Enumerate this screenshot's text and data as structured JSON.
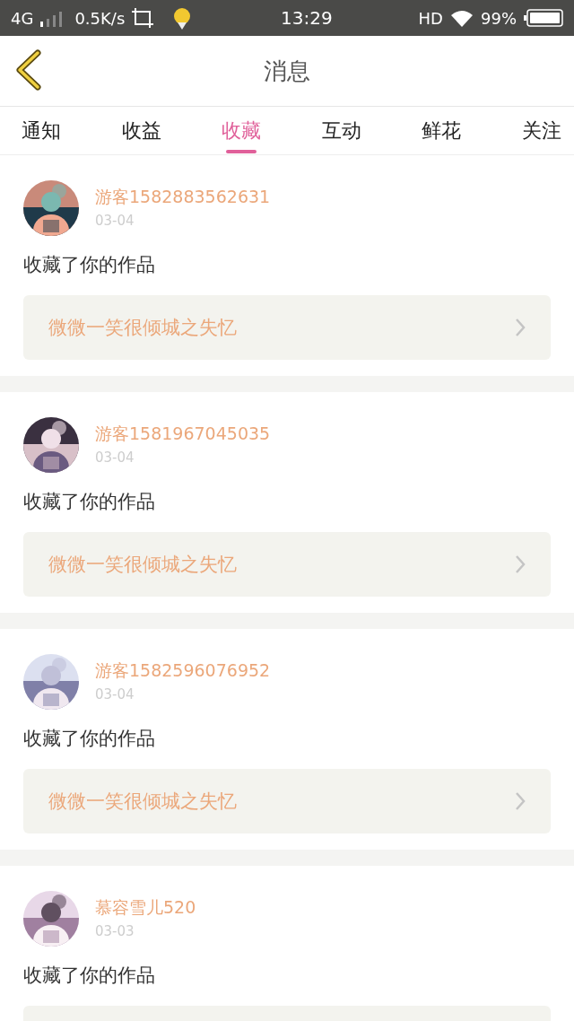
{
  "status_bar": {
    "network": "4G",
    "speed": "0.5K/s",
    "time": "13:29",
    "hd": "HD",
    "battery": "99%"
  },
  "header": {
    "title": "消息"
  },
  "tabs": [
    {
      "label": "通知",
      "selected": false
    },
    {
      "label": "收益",
      "selected": false
    },
    {
      "label": "收藏",
      "selected": true
    },
    {
      "label": "互动",
      "selected": false
    },
    {
      "label": "鲜花",
      "selected": false
    },
    {
      "label": "关注",
      "selected": false
    }
  ],
  "messages": [
    {
      "user": "游客1582883562631",
      "date": "03-04",
      "text": "收藏了你的作品",
      "work": "微微一笑很倾城之失忆"
    },
    {
      "user": "游客1581967045035",
      "date": "03-04",
      "text": "收藏了你的作品",
      "work": "微微一笑很倾城之失忆"
    },
    {
      "user": "游客1582596076952",
      "date": "03-04",
      "text": "收藏了你的作品",
      "work": "微微一笑很倾城之失忆"
    },
    {
      "user": "慕容雪儿520",
      "date": "03-03",
      "text": "收藏了你的作品"
    }
  ]
}
